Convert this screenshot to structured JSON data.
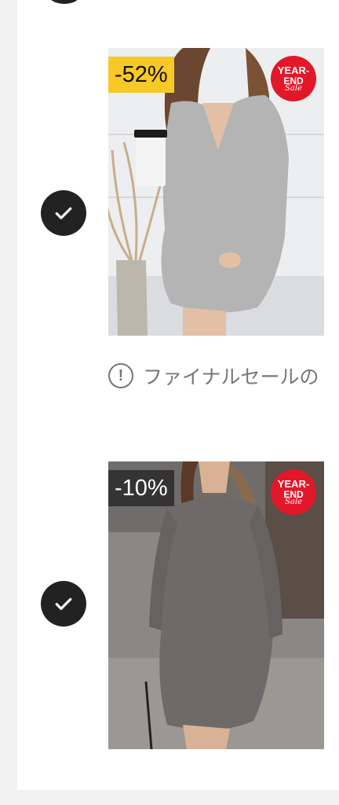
{
  "items": [
    {
      "discount": "-52%",
      "badge": {
        "line1": "YEAR-",
        "line2": "END",
        "line3": "Sale"
      },
      "selected": true,
      "image": "gray ribbed v-neck collared sweater dress with coffee cup"
    },
    {
      "discount": "-10%",
      "badge": {
        "line1": "YEAR-",
        "line2": "END",
        "line3": "Sale"
      },
      "selected": true,
      "image": "gray ribbed crew-neck sweater dress on street"
    }
  ],
  "notice": {
    "text": "ファイナルセールの",
    "icon": "exclamation-circle-icon"
  },
  "colors": {
    "discount_yellow": "#f6c927",
    "badge_red": "#e2172a",
    "check_bg": "#222222"
  }
}
